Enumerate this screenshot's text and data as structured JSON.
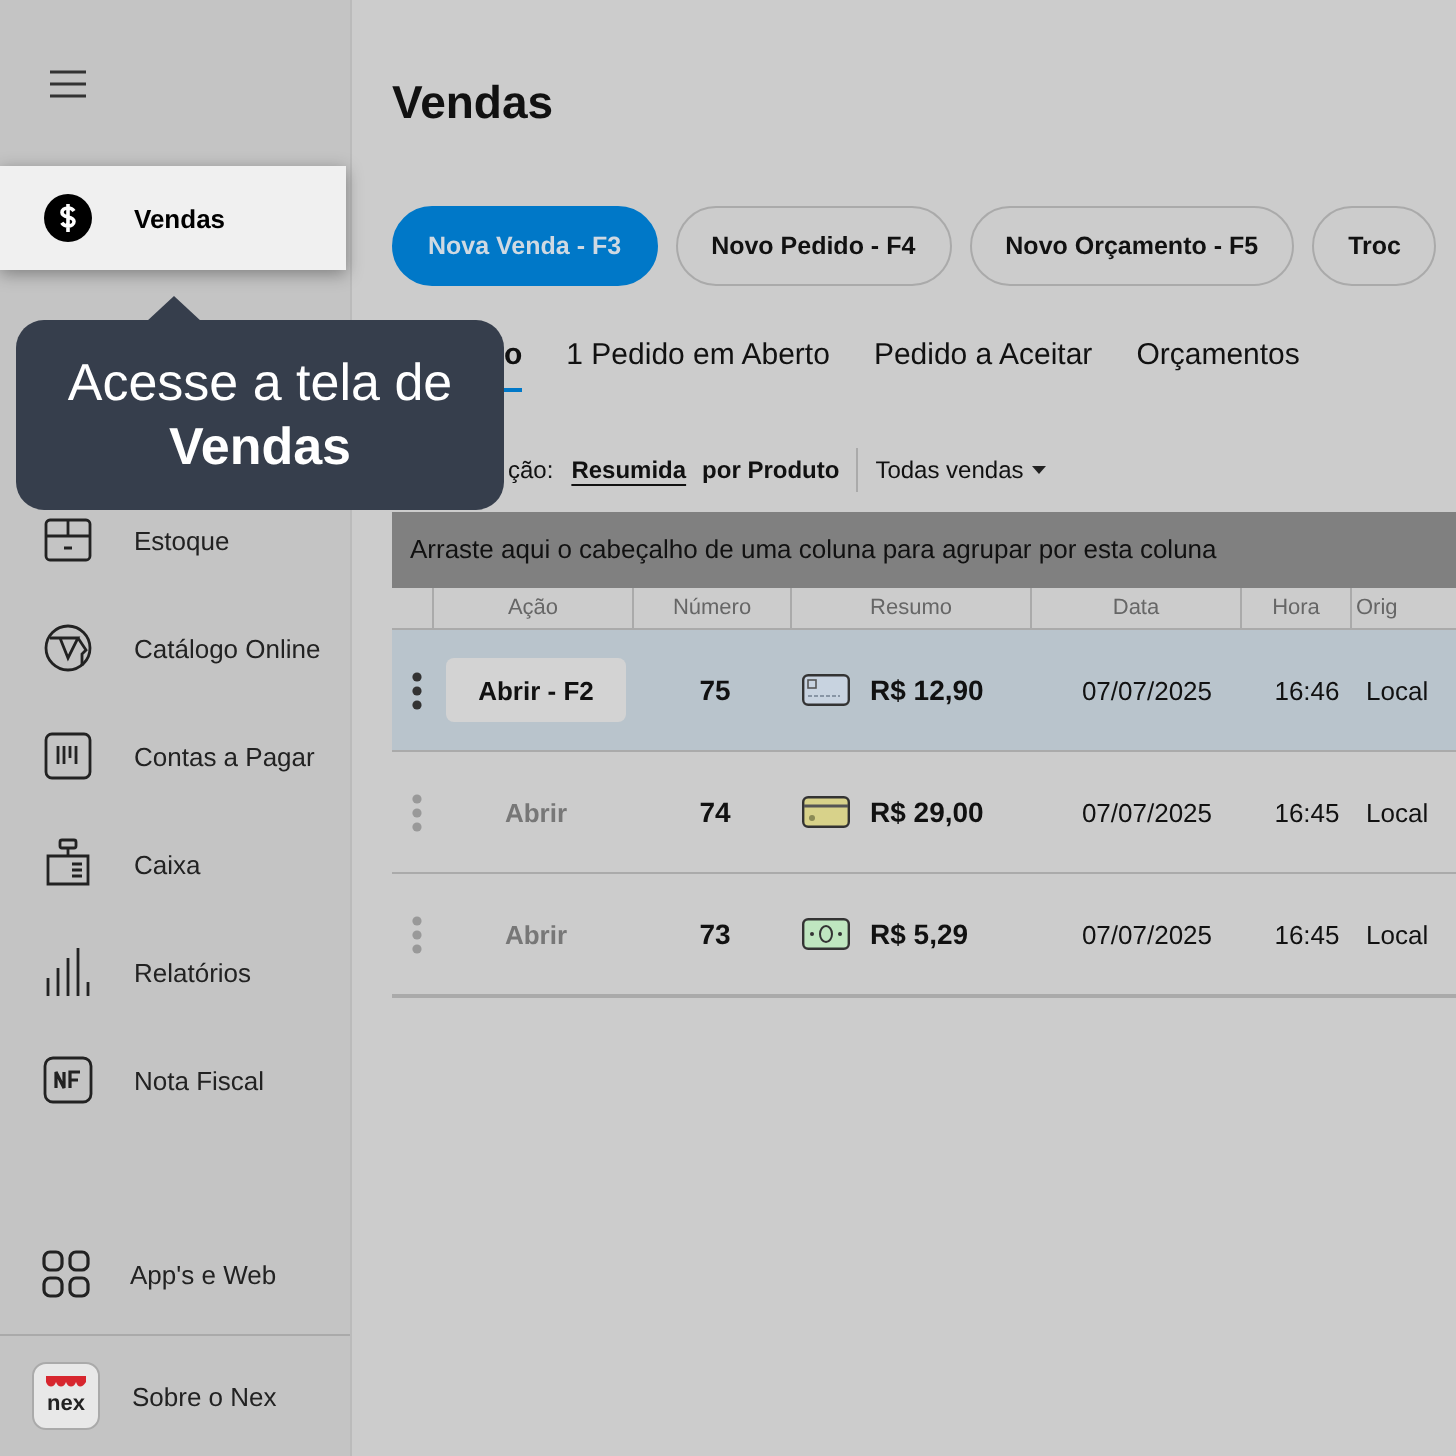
{
  "sidebar": {
    "items": [
      {
        "label": "Vendas",
        "selected": true
      },
      {
        "label": "Estoque",
        "selected": false
      },
      {
        "label": "Catálogo Online",
        "selected": false
      },
      {
        "label": "Contas a Pagar",
        "selected": false
      },
      {
        "label": "Caixa",
        "selected": false
      },
      {
        "label": "Relatórios",
        "selected": false
      },
      {
        "label": "Nota Fiscal",
        "selected": false
      }
    ],
    "bottom_items": [
      {
        "label": "App's e Web"
      },
      {
        "label": "Sobre o Nex",
        "logo_text": "nex"
      }
    ]
  },
  "tooltip": {
    "text": "Acesse a tela de **Vendas**"
  },
  "page": {
    "title": "Vendas"
  },
  "actions": [
    {
      "label": "Nova Venda - F3",
      "kind": "primary"
    },
    {
      "label": "Novo Pedido - F4",
      "kind": "outline"
    },
    {
      "label": "Novo Orçamento - F5",
      "kind": "outline"
    },
    {
      "label": "Troc",
      "kind": "outline"
    }
  ],
  "tabs": [
    {
      "label": "o",
      "selected": true
    },
    {
      "label": "1 Pedido em Aberto",
      "selected": false
    },
    {
      "label": "Pedido a Aceitar",
      "selected": false
    },
    {
      "label": "Orçamentos",
      "selected": false
    }
  ],
  "view": {
    "label": "ção:",
    "options": [
      {
        "label": "Resumida",
        "selected": true
      },
      {
        "label": "por Produto",
        "selected": false
      }
    ],
    "filter": "Todas vendas"
  },
  "table": {
    "group_hint": "Arraste aqui o cabeçalho de uma coluna para agrupar por esta coluna",
    "columns": [
      "Ação",
      "Número",
      "Resumo",
      "Data",
      "Hora",
      "Orig"
    ],
    "rows": [
      {
        "selected": true,
        "action": "Abrir - F2",
        "number": "75",
        "kind": "card",
        "amount": "R$ 12,90",
        "date": "07/07/2025",
        "time": "16:46",
        "origin": "Local"
      },
      {
        "selected": false,
        "action": "Abrir",
        "number": "74",
        "kind": "voucher",
        "amount": "R$ 29,00",
        "date": "07/07/2025",
        "time": "16:45",
        "origin": "Local"
      },
      {
        "selected": false,
        "action": "Abrir",
        "number": "73",
        "kind": "cash",
        "amount": "R$ 5,29",
        "date": "07/07/2025",
        "time": "16:45",
        "origin": "Local"
      }
    ]
  }
}
